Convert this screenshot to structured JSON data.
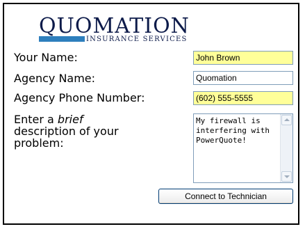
{
  "logo": {
    "main": "QUOMATION",
    "sub": "INSURANCE SERVICES"
  },
  "form": {
    "name_label": "Your Name:",
    "name_value": "John Brown",
    "agency_label": "Agency Name:",
    "agency_value": "Quomation",
    "phone_label": "Agency Phone Number:",
    "phone_value": "(602) 555-5555",
    "desc_label_pre": "Enter a ",
    "desc_label_em": "brief",
    "desc_label_post": " description of your problem:",
    "desc_value": "My firewall is interfering with PowerQuote!",
    "submit_label": "Connect to Technician"
  },
  "colors": {
    "highlight_field": "#ffff99",
    "logo_navy": "#0d1b4a",
    "logo_blue": "#2e7fbd"
  },
  "icons": [
    "scroll-up-arrow-icon",
    "scroll-down-arrow-icon"
  ]
}
